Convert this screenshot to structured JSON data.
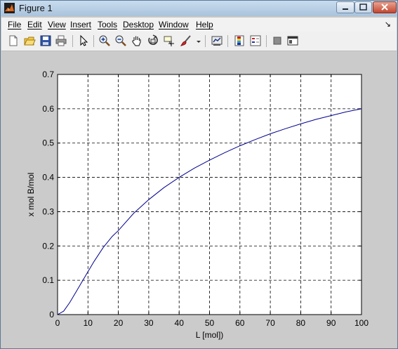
{
  "window": {
    "title": "Figure 1",
    "min_symbol": "",
    "max_symbol": "",
    "close_symbol": "✕"
  },
  "menu": [
    {
      "label": "File"
    },
    {
      "label": "Edit"
    },
    {
      "label": "View"
    },
    {
      "label": "Insert"
    },
    {
      "label": "Tools"
    },
    {
      "label": "Desktop"
    },
    {
      "label": "Window"
    },
    {
      "label": "Help"
    }
  ],
  "menu_dock_arrow": "↘",
  "toolbar": [
    {
      "icon": "new-figure-icon"
    },
    {
      "icon": "open-file-icon"
    },
    {
      "icon": "save-icon"
    },
    {
      "icon": "print-icon"
    },
    {
      "icon": "edit-plot-arrow-icon"
    },
    {
      "icon": "zoom-in-icon"
    },
    {
      "icon": "zoom-out-icon"
    },
    {
      "icon": "pan-hand-icon"
    },
    {
      "icon": "rotate-3d-icon"
    },
    {
      "icon": "data-cursor-icon"
    },
    {
      "icon": "brush-icon"
    },
    {
      "icon": "link-plot-icon"
    },
    {
      "icon": "insert-colorbar-icon"
    },
    {
      "icon": "insert-legend-icon"
    },
    {
      "icon": "hide-plot-tools-icon"
    },
    {
      "icon": "show-plot-tools-icon"
    }
  ],
  "chart_data": {
    "type": "line",
    "title": "",
    "xlabel": "L [mol])",
    "ylabel": "x mol B/mol",
    "xlim": [
      0,
      100
    ],
    "ylim": [
      0,
      0.7
    ],
    "xticks": [
      0,
      10,
      20,
      30,
      40,
      50,
      60,
      70,
      80,
      90,
      100
    ],
    "yticks": [
      0,
      0.1,
      0.2,
      0.3,
      0.4,
      0.5,
      0.6,
      0.7
    ],
    "grid": true,
    "line_color": "#00008f",
    "series": [
      {
        "x": [
          0,
          2,
          4,
          6,
          8,
          10,
          12,
          15,
          18,
          20,
          25,
          30,
          35,
          40,
          45,
          50,
          55,
          60,
          65,
          70,
          75,
          80,
          85,
          90,
          95,
          100
        ],
        "y": [
          0,
          0.01,
          0.035,
          0.065,
          0.095,
          0.125,
          0.155,
          0.195,
          0.228,
          0.245,
          0.295,
          0.335,
          0.37,
          0.4,
          0.427,
          0.45,
          0.472,
          0.492,
          0.51,
          0.527,
          0.542,
          0.556,
          0.569,
          0.58,
          0.591,
          0.6
        ]
      }
    ]
  }
}
